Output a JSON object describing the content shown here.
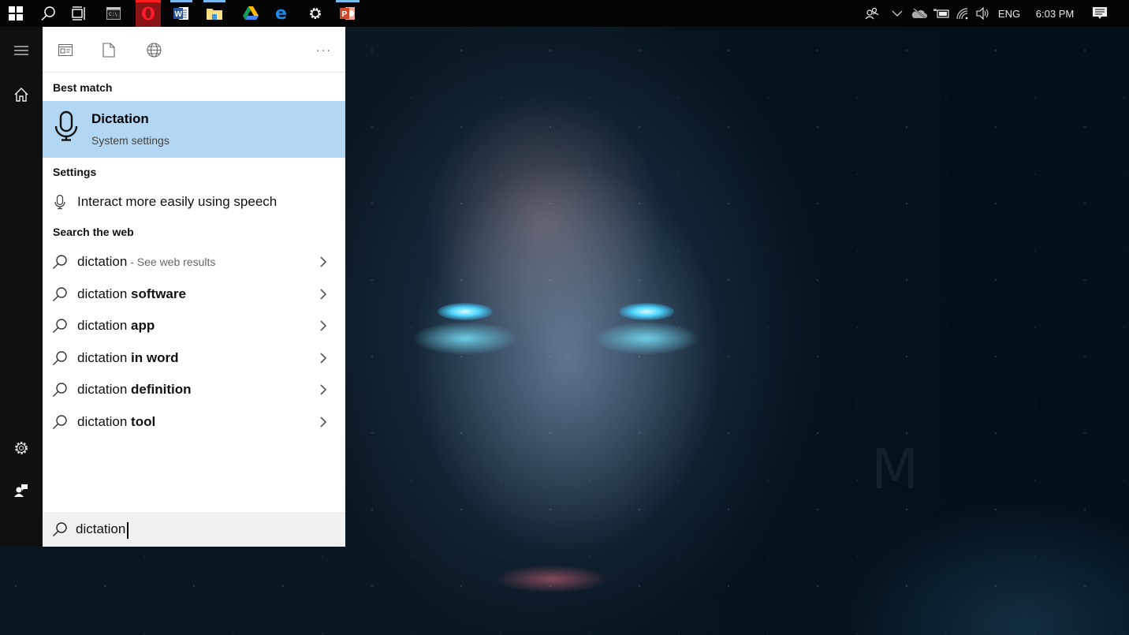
{
  "taskbar": {
    "apps": [
      {
        "name": "start",
        "icon": "windows-logo-icon"
      },
      {
        "name": "search",
        "icon": "search-icon"
      },
      {
        "name": "task-view",
        "icon": "task-view-icon"
      },
      {
        "name": "command-prompt",
        "icon": "terminal-icon"
      },
      {
        "name": "opera",
        "icon": "opera-icon",
        "active": true
      },
      {
        "name": "word",
        "icon": "word-icon"
      },
      {
        "name": "file-explorer",
        "icon": "folder-icon"
      },
      {
        "name": "google-drive",
        "icon": "google-drive-icon"
      },
      {
        "name": "edge",
        "icon": "edge-icon"
      },
      {
        "name": "settings",
        "icon": "gear-icon"
      },
      {
        "name": "powerpoint",
        "icon": "powerpoint-icon"
      }
    ],
    "tray": {
      "language": "ENG",
      "time": "6:03 PM"
    },
    "colors": {
      "active_app_bg": "#8b1515",
      "running_indicator": "#76b9ed",
      "active_indicator": "#ff1f1f"
    }
  },
  "start_rail": {
    "items": [
      {
        "name": "menu",
        "icon": "hamburger-icon"
      },
      {
        "name": "home",
        "icon": "home-icon"
      },
      {
        "name": "settings",
        "icon": "gear-icon"
      },
      {
        "name": "feedback",
        "icon": "feedback-icon"
      }
    ]
  },
  "search_panel": {
    "filters": [
      {
        "name": "apps",
        "icon": "apps-filter-icon"
      },
      {
        "name": "documents",
        "icon": "document-icon"
      },
      {
        "name": "web",
        "icon": "globe-icon"
      }
    ],
    "more_label": "···",
    "best_match": {
      "heading": "Best match",
      "title": "Dictation",
      "subtitle": "System settings",
      "icon": "microphone-icon",
      "highlight_color": "#b3d7f2"
    },
    "settings": {
      "heading": "Settings",
      "items": [
        {
          "label": "Interact more easily using speech",
          "icon": "microphone-icon"
        }
      ]
    },
    "web": {
      "heading": "Search the web",
      "items": [
        {
          "prefix": "dictation",
          "bold": "",
          "hint": " - See web results"
        },
        {
          "prefix": "dictation ",
          "bold": "software",
          "hint": ""
        },
        {
          "prefix": "dictation ",
          "bold": "app",
          "hint": ""
        },
        {
          "prefix": "dictation ",
          "bold": "in word",
          "hint": ""
        },
        {
          "prefix": "dictation ",
          "bold": "definition",
          "hint": ""
        },
        {
          "prefix": "dictation ",
          "bold": "tool",
          "hint": ""
        }
      ]
    },
    "search_box": {
      "value": "dictation",
      "placeholder": ""
    }
  },
  "wallpaper": {
    "description": "dark blue portrait of wet man with glowing cyan eyes",
    "watermark": "M"
  }
}
